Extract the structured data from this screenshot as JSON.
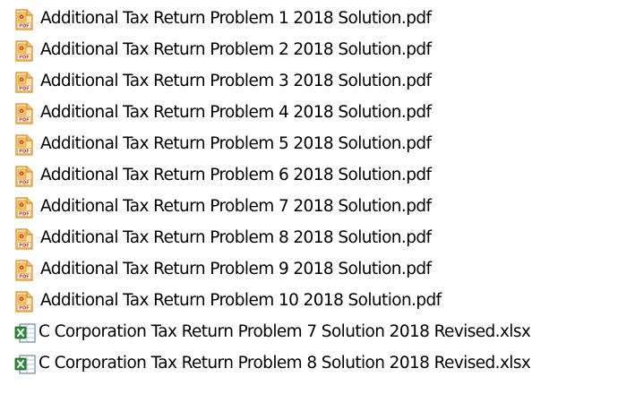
{
  "files": [
    {
      "name": "Additional Tax Return Problem 1 2018 Solution.pdf",
      "type": "pdf",
      "icon": "pdf-file-icon"
    },
    {
      "name": "Additional Tax Return Problem 2 2018 Solution.pdf",
      "type": "pdf",
      "icon": "pdf-file-icon"
    },
    {
      "name": "Additional Tax Return Problem 3 2018 Solution.pdf",
      "type": "pdf",
      "icon": "pdf-file-icon"
    },
    {
      "name": "Additional Tax Return Problem 4 2018 Solution.pdf",
      "type": "pdf",
      "icon": "pdf-file-icon"
    },
    {
      "name": "Additional Tax Return Problem 5 2018 Solution.pdf",
      "type": "pdf",
      "icon": "pdf-file-icon"
    },
    {
      "name": "Additional Tax Return Problem 6 2018 Solution.pdf",
      "type": "pdf",
      "icon": "pdf-file-icon"
    },
    {
      "name": "Additional Tax Return Problem 7 2018 Solution.pdf",
      "type": "pdf",
      "icon": "pdf-file-icon"
    },
    {
      "name": "Additional Tax Return Problem 8 2018 Solution.pdf",
      "type": "pdf",
      "icon": "pdf-file-icon"
    },
    {
      "name": "Additional Tax Return Problem 9 2018 Solution.pdf",
      "type": "pdf",
      "icon": "pdf-file-icon"
    },
    {
      "name": "Additional Tax Return Problem 10 2018 Solution.pdf",
      "type": "pdf",
      "icon": "pdf-file-icon"
    },
    {
      "name": "C Corporation Tax Return Problem 7 Solution 2018 Revised.xlsx",
      "type": "xlsx",
      "icon": "excel-file-icon"
    },
    {
      "name": "C Corporation Tax Return Problem 8 Solution 2018 Revised.xlsx",
      "type": "xlsx",
      "icon": "excel-file-icon"
    }
  ],
  "colors": {
    "pdf_fill": "#f7c46a",
    "pdf_stroke": "#d88a1e",
    "pdf_accent": "#c0392b",
    "excel_fill": "#2e8b3e",
    "excel_sheet": "#ffffff",
    "excel_stroke": "#4a6f8f",
    "text": "#000000",
    "background": "#ffffff"
  }
}
